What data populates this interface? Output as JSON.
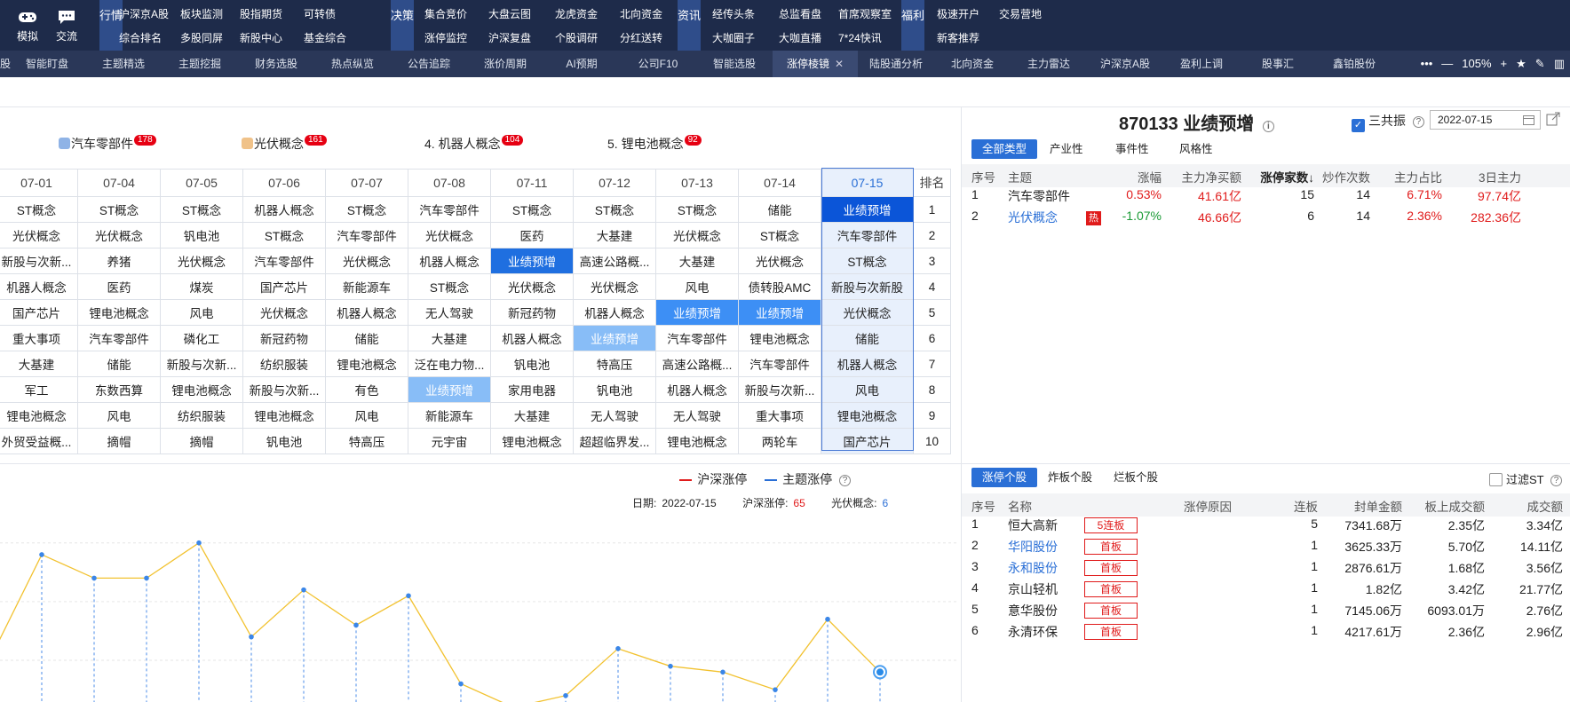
{
  "topnav": {
    "left_buttons": [
      {
        "label": "模拟",
        "icon": "gamepad-icon"
      },
      {
        "label": "交流",
        "icon": "chat-icon"
      }
    ],
    "groups": [
      {
        "tag": "行情",
        "items": [
          [
            "沪深京A股",
            "板块监测",
            "股指期货",
            "可转债"
          ],
          [
            "综合排名",
            "多股同屏",
            "新股中心",
            "基金综合"
          ]
        ]
      },
      {
        "tag": "决策",
        "items": [
          [
            "集合竞价",
            "大盘云图",
            "龙虎资金",
            "北向资金"
          ],
          [
            "涨停监控",
            "沪深复盘",
            "个股调研",
            "分红送转"
          ]
        ]
      },
      {
        "tag": "资讯",
        "items": [
          [
            "经传头条",
            "总监看盘",
            "首席观察室"
          ],
          [
            "大咖圈子",
            "大咖直播",
            "7*24快讯"
          ]
        ]
      },
      {
        "tag": "福利",
        "items": [
          [
            "极速开户",
            "交易营地"
          ],
          [
            "新客推荐"
          ]
        ]
      }
    ]
  },
  "tabs": {
    "items": [
      "智能盯盘",
      "主题精选",
      "主题挖掘",
      "财务选股",
      "热点纵览",
      "公告追踪",
      "涨价周期",
      "AI预期",
      "公司F10",
      "智能选股",
      "涨停棱镜",
      "陆股通分析",
      "北向资金",
      "主力雷达",
      "沪深京A股",
      "盈利上调",
      "股事汇",
      "鑫铂股份"
    ],
    "first_partial": "股",
    "active": "涨停棱镜",
    "close_glyph": "✕",
    "tools": [
      "•••",
      "—",
      "105%",
      "+",
      "★",
      "✎",
      "▥"
    ]
  },
  "concepts": [
    {
      "label": "汽车零部件",
      "count": "178",
      "prefix": "",
      "color": "#8fb3e6"
    },
    {
      "label": "光伏概念",
      "count": "161",
      "prefix": "",
      "color": "#f0c289"
    },
    {
      "label": "机器人概念",
      "count": "104",
      "prefix": "4. ",
      "color": ""
    },
    {
      "label": "锂电池概念",
      "count": "92",
      "prefix": "5. ",
      "color": ""
    }
  ],
  "grid": {
    "dates": [
      "07-01",
      "07-04",
      "07-05",
      "07-06",
      "07-07",
      "07-08",
      "07-11",
      "07-12",
      "07-13",
      "07-14",
      "07-15"
    ],
    "rank_header": "排名",
    "rows": [
      [
        "ST概念",
        "ST概念",
        "ST概念",
        "机器人概念",
        "ST概念",
        "汽车零部件",
        "ST概念",
        "ST概念",
        "ST概念",
        "储能",
        "业绩预增"
      ],
      [
        "光伏概念",
        "光伏概念",
        "钒电池",
        "ST概念",
        "汽车零部件",
        "光伏概念",
        "医药",
        "大基建",
        "光伏概念",
        "ST概念",
        "汽车零部件"
      ],
      [
        "新股与次新...",
        "养猪",
        "光伏概念",
        "汽车零部件",
        "光伏概念",
        "机器人概念",
        "业绩预增",
        "高速公路概...",
        "大基建",
        "光伏概念",
        "ST概念"
      ],
      [
        "机器人概念",
        "医药",
        "煤炭",
        "国产芯片",
        "新能源车",
        "ST概念",
        "光伏概念",
        "光伏概念",
        "风电",
        "债转股AMC",
        "新股与次新股"
      ],
      [
        "国产芯片",
        "锂电池概念",
        "风电",
        "光伏概念",
        "机器人概念",
        "无人驾驶",
        "新冠药物",
        "机器人概念",
        "业绩预增",
        "业绩预增",
        "光伏概念"
      ],
      [
        "重大事项",
        "汽车零部件",
        "磷化工",
        "新冠药物",
        "储能",
        "大基建",
        "机器人概念",
        "业绩预增",
        "汽车零部件",
        "锂电池概念",
        "储能"
      ],
      [
        "大基建",
        "储能",
        "新股与次新...",
        "纺织服装",
        "锂电池概念",
        "泛在电力物...",
        "钒电池",
        "特高压",
        "高速公路概...",
        "汽车零部件",
        "机器人概念"
      ],
      [
        "军工",
        "东数西算",
        "锂电池概念",
        "新股与次新...",
        "有色",
        "业绩预增",
        "家用电器",
        "钒电池",
        "机器人概念",
        "新股与次新...",
        "风电"
      ],
      [
        "锂电池概念",
        "风电",
        "纺织服装",
        "锂电池概念",
        "风电",
        "新能源车",
        "大基建",
        "无人驾驶",
        "无人驾驶",
        "重大事项",
        "锂电池概念"
      ],
      [
        "外贸受益概...",
        "摘帽",
        "摘帽",
        "钒电池",
        "特高压",
        "元宇宙",
        "锂电池概念",
        "超超临界发...",
        "锂电池概念",
        "两轮车",
        "国产芯片"
      ]
    ],
    "ranks": [
      "1",
      "2",
      "3",
      "4",
      "5",
      "6",
      "7",
      "8",
      "9",
      "10"
    ]
  },
  "legend": {
    "items": [
      {
        "label": "沪深涨停",
        "color": "#e01b1b"
      },
      {
        "label": "主题涨停",
        "color": "#2a6fd6"
      }
    ],
    "help": "?"
  },
  "dateinfo": {
    "date_label": "日期:",
    "date": "2022-07-15",
    "limit_label": "沪深涨停:",
    "limit_value": "65",
    "theme_label": "光伏概念:",
    "theme_value": "6"
  },
  "chart_data": {
    "type": "line",
    "title": "",
    "xlabel": "",
    "ylabel": "",
    "x": [
      "p1",
      "p2",
      "p3",
      "p4",
      "p5",
      "p6",
      "p7",
      "p8",
      "p9",
      "p10",
      "p11",
      "p12",
      "p13",
      "p14",
      "p15",
      "p16",
      "p17",
      "p18"
    ],
    "series": [
      {
        "name": "主题涨停",
        "color": "#f2c230",
        "values": [
          4,
          13,
          11,
          11,
          14,
          6,
          10,
          7,
          9.5,
          2,
          0,
          1,
          5,
          3.5,
          3,
          1.5,
          7.5,
          3
        ]
      }
    ],
    "ylim": [
      0,
      17
    ],
    "grid": true
  },
  "right": {
    "title": "870133 业绩预增",
    "gongzhen_label": "三共振",
    "date_value": "2022-07-15",
    "type_tabs": [
      "全部类型",
      "产业性",
      "事件性",
      "风格性"
    ],
    "type_active": "全部类型",
    "theme_headers": [
      "序号",
      "主题",
      "涨幅",
      "主力净买额",
      "涨停家数↓",
      "炒作次数",
      "主力占比",
      "3日主力"
    ],
    "theme_rows": [
      {
        "no": "1",
        "name": "汽车零部件",
        "hot": "",
        "chg": "0.53%",
        "net": "41.61亿",
        "limit": "15",
        "times": "14",
        "ratio": "6.71%",
        "d3": "97.74亿"
      },
      {
        "no": "2",
        "name": "光伏概念",
        "hot": "热",
        "chg": "-1.07%",
        "net": "46.66亿",
        "limit": "6",
        "times": "14",
        "ratio": "2.36%",
        "d3": "282.36亿"
      }
    ],
    "stock_tabs": [
      "涨停个股",
      "炸板个股",
      "烂板个股"
    ],
    "stock_active": "涨停个股",
    "filter_st": "过滤ST",
    "stock_headers": [
      "序号",
      "名称",
      "涨停原因",
      "连板",
      "封单金额",
      "板上成交额",
      "成交额"
    ],
    "stock_rows": [
      {
        "no": "1",
        "name": "恒大高新",
        "tag": "5连板",
        "link": false,
        "lb": "5",
        "seal": "7341.68万",
        "board": "2.35亿",
        "amt": "3.34亿"
      },
      {
        "no": "2",
        "name": "华阳股份",
        "tag": "首板",
        "link": true,
        "lb": "1",
        "seal": "3625.33万",
        "board": "5.70亿",
        "amt": "14.11亿"
      },
      {
        "no": "3",
        "name": "永和股份",
        "tag": "首板",
        "link": true,
        "lb": "1",
        "seal": "2876.61万",
        "board": "1.68亿",
        "amt": "3.56亿"
      },
      {
        "no": "4",
        "name": "京山轻机",
        "tag": "首板",
        "link": false,
        "lb": "1",
        "seal": "1.82亿",
        "board": "3.42亿",
        "amt": "21.77亿"
      },
      {
        "no": "5",
        "name": "意华股份",
        "tag": "首板",
        "link": false,
        "lb": "1",
        "seal": "7145.06万",
        "board": "6093.01万",
        "amt": "2.76亿"
      },
      {
        "no": "6",
        "name": "永清环保",
        "tag": "首板",
        "link": false,
        "lb": "1",
        "seal": "4217.61万",
        "board": "2.36亿",
        "amt": "2.96亿"
      }
    ]
  }
}
